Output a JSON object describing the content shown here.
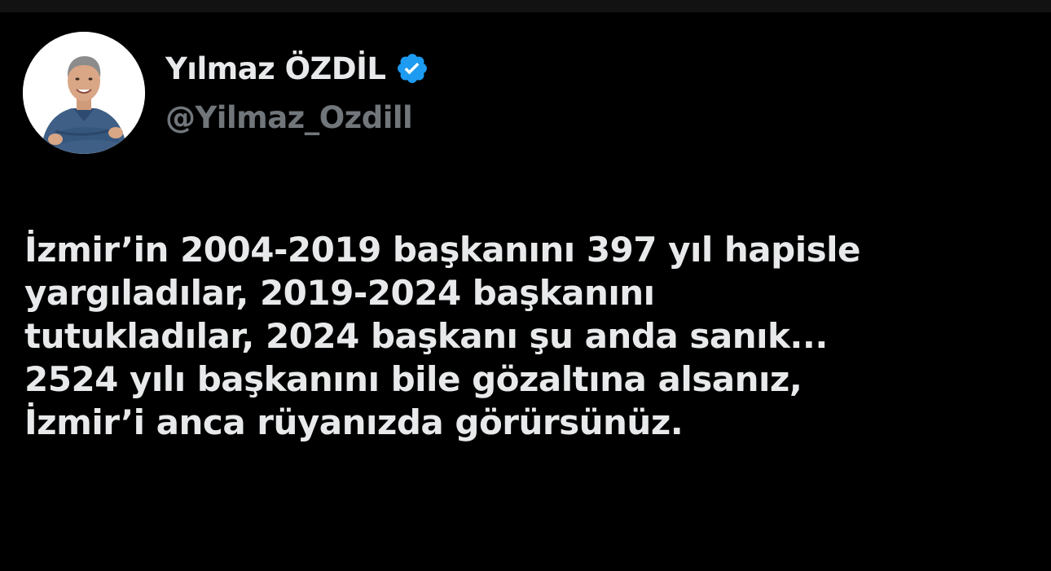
{
  "author": {
    "name": "Yılmaz ÖZDİL",
    "handle": "@Yilmaz_Ozdill",
    "verified": true,
    "avatar_icon": "person-portrait-avatar",
    "verified_icon": "verified-badge-icon"
  },
  "tweet": {
    "lines": [
      "İzmir’in 2004-2019 başkanını 397 yıl hapisle",
      "yargıladılar, 2019-2024 başkanını",
      "tutukladılar, 2024 başkanı şu anda sanık...",
      "2524 yılı başkanını bile gözaltına alsanız,",
      "İzmir’i anca rüyanızda görürsünüz."
    ]
  },
  "colors": {
    "background": "#000000",
    "text_primary": "#e7e9ea",
    "text_secondary": "#71767b",
    "verified_blue": "#1d9bf0"
  }
}
